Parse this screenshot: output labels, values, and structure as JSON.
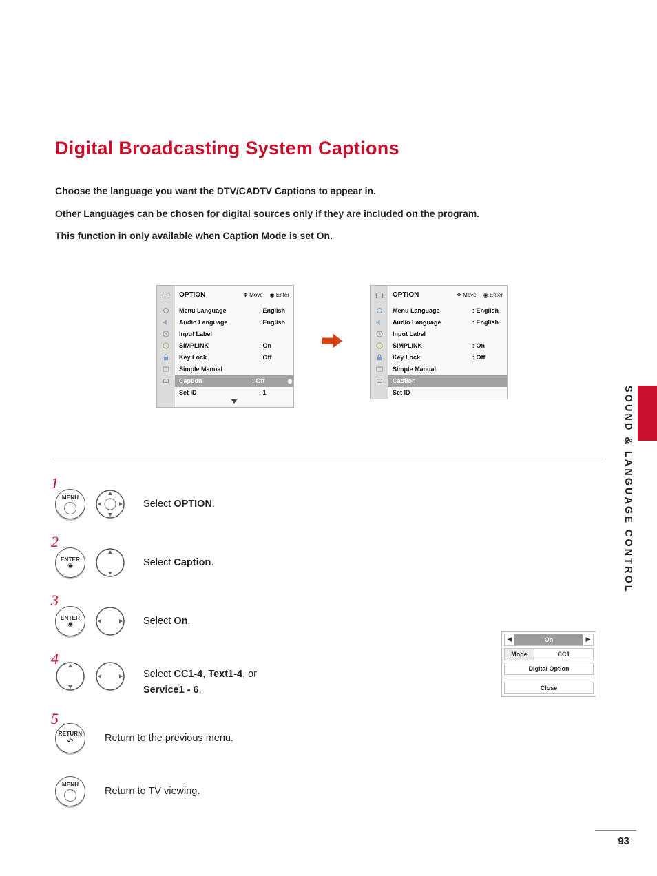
{
  "sidebar": {
    "section": "SOUND & LANGUAGE CONTROL"
  },
  "header": {
    "title": "Digital Broadcasting System Captions",
    "intro1": "Choose the language you want the DTV/CADTV Captions to appear in.",
    "intro2": "Other Languages can be chosen for digital sources only if they are included on the program.",
    "intro3a": "This function in only available when",
    "intro3b": "Caption",
    "intro3c": "Mode is set",
    "intro3d": "On",
    "intro3e": "."
  },
  "osd_left": {
    "heading": "OPTION",
    "hints": [
      "Move",
      "Enter"
    ],
    "items": [
      {
        "label": "Menu Language",
        "value": ": English"
      },
      {
        "label": "Audio Language",
        "value": ": English"
      },
      {
        "label": "Input Label",
        "value": ""
      },
      {
        "label": "SIMPLINK",
        "value": ": On"
      },
      {
        "label": "Key Lock",
        "value": ": Off"
      },
      {
        "label": "Simple Manual",
        "value": ""
      },
      {
        "label": "Caption",
        "value": ": Off"
      },
      {
        "label": "Set ID",
        "value": ": 1"
      }
    ]
  },
  "osd_right": {
    "heading": "OPTION",
    "hints": [
      "Move",
      "Enter"
    ],
    "items": [
      {
        "label": "Menu Language",
        "value": ": English"
      },
      {
        "label": "Audio Language",
        "value": ": English"
      },
      {
        "label": "Input Label",
        "value": ""
      },
      {
        "label": "SIMPLINK",
        "value": ": On"
      },
      {
        "label": "Key Lock",
        "value": ": Off"
      },
      {
        "label": "Simple Manual",
        "value": ""
      },
      {
        "label": "Caption",
        "value": ""
      },
      {
        "label": "Set ID",
        "value": ""
      }
    ]
  },
  "popup": {
    "on": "On",
    "mode_label": "Mode",
    "mode_value": "CC1",
    "digital": "Digital Option",
    "close": "Close"
  },
  "remote": {
    "menu": "MENU",
    "enter": "ENTER",
    "return": "RETURN"
  },
  "steps": [
    {
      "num": "1",
      "pre": "Select",
      "bold": "OPTION",
      "post": "."
    },
    {
      "num": "2",
      "pre": "Select",
      "bold": "Caption",
      "post": "."
    },
    {
      "num": "3",
      "pre": "Select",
      "bold": "On",
      "post": "."
    },
    {
      "num": "4",
      "pre": "Select ",
      "bold1": "CC1-4",
      "mid1": ",",
      "bold2": "Text1-4",
      "mid2": ", or",
      "bold3": "Service1 - 6",
      "post": "."
    },
    {
      "num": "5",
      "text": "Return to the previous menu."
    },
    {
      "num": "",
      "text": "Return to TV viewing."
    }
  ],
  "footer": {
    "page": "93"
  }
}
